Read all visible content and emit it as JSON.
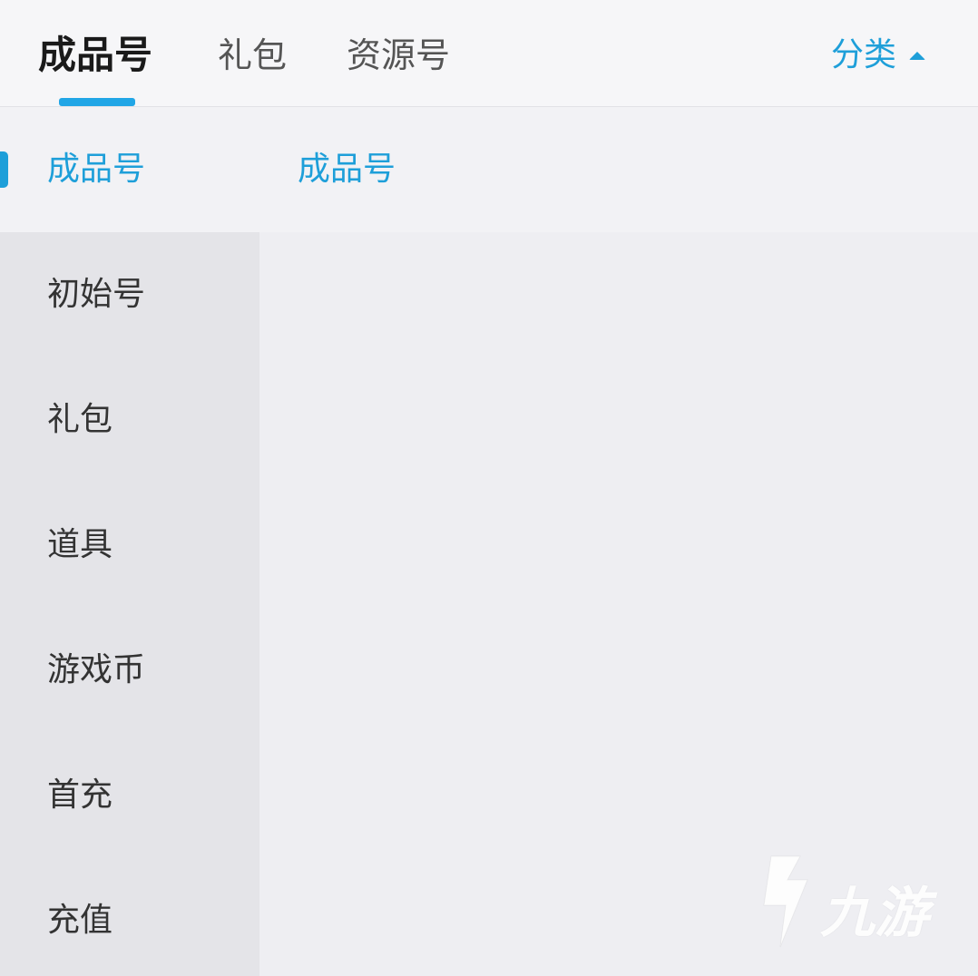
{
  "tabs": [
    {
      "label": "成品号",
      "active": true
    },
    {
      "label": "礼包",
      "active": false
    },
    {
      "label": "资源号",
      "active": false
    }
  ],
  "category_toggle": {
    "label": "分类",
    "icon": "caret-up-icon"
  },
  "sidebar": {
    "items": [
      {
        "label": "成品号",
        "active": true
      },
      {
        "label": "初始号",
        "active": false
      },
      {
        "label": "礼包",
        "active": false
      },
      {
        "label": "道具",
        "active": false
      },
      {
        "label": "游戏币",
        "active": false
      },
      {
        "label": "首充",
        "active": false
      },
      {
        "label": "充值",
        "active": false
      }
    ]
  },
  "content": {
    "title": "成品号"
  },
  "watermark": {
    "text": "九游",
    "icon": "jiuyou-logo-icon"
  },
  "colors": {
    "accent": "#1e9fd9",
    "tab_underline": "#21a6e6",
    "sidebar_bg": "#e4e4e8",
    "content_bg": "#eeeef2",
    "active_bg": "#f2f2f5"
  }
}
